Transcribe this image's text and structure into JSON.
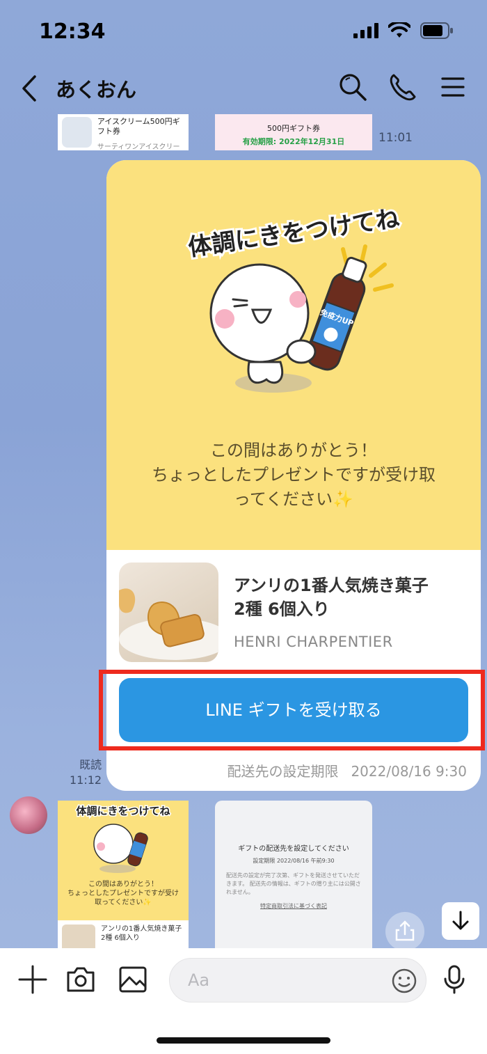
{
  "status_bar": {
    "time": "12:34"
  },
  "nav": {
    "title": "あくおん"
  },
  "prev_messages": {
    "ice_cream": {
      "title": "アイスクリーム500円ギフト券",
      "brand": "サーティワンアイスクリーム"
    },
    "ticket": {
      "title": "500円ギフト券",
      "expiry": "有効期限: 2022年12月31日"
    },
    "time": "11:01"
  },
  "gift": {
    "sticker_text": "体調にきをつけてね",
    "bottle_label": "免疫力UP",
    "message_line1": "この間はありがとう！",
    "message_line2": "ちょっとしたプレゼントですが受け取",
    "message_line3": "ってください✨",
    "product_name_line1": "アンリの1番人気焼き菓子",
    "product_name_line2": "2種 6個入り",
    "product_brand": "HENRI CHARPENTIER",
    "receive_label": "LINE ギフトを受け取る",
    "deadline_label": "配送先の設定期限",
    "deadline_value": "2022/08/16 9:30"
  },
  "read": {
    "label": "既読",
    "time": "11:12"
  },
  "preview": {
    "sticker_text": "体調にきをつけてね",
    "message_line1": "この間はありがとう！",
    "message_line2": "ちょっとしたプレゼントですが受け",
    "message_line3": "取ってください✨",
    "product_name_line1": "アンリの1番人気焼き菓子",
    "product_name_line2": "2種 6個入り",
    "doc_title": "ギフトの配送先を設定してください",
    "doc_deadline": "設定期限 2022/08/16 午前9:30",
    "doc_body": "配送先の設定が完了次第、ギフトを発送させていただきます。 配送先の情報は、ギフトの贈り主には公開されません。",
    "doc_link": "特定商取引法に基づく表記"
  },
  "input": {
    "placeholder": "Aa"
  },
  "colors": {
    "button": "#2b96e2",
    "highlight": "#ee2a1e",
    "card_yellow": "#fbe17e"
  }
}
